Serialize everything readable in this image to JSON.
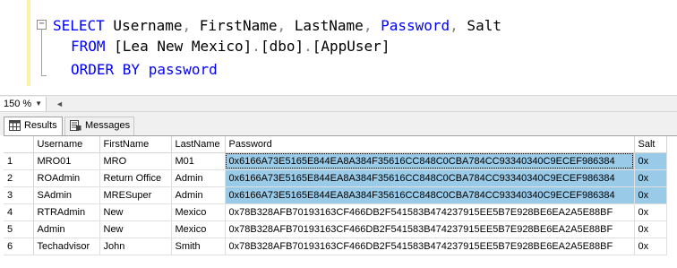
{
  "editor": {
    "collapse_glyph": "−",
    "line1": [
      {
        "t": "SELECT",
        "c": "kw"
      },
      {
        "t": " Username",
        "c": ""
      },
      {
        "t": ",",
        "c": "gray"
      },
      {
        "t": " FirstName",
        "c": ""
      },
      {
        "t": ",",
        "c": "gray"
      },
      {
        "t": " LastName",
        "c": ""
      },
      {
        "t": ",",
        "c": "gray"
      },
      {
        "t": " Password",
        "c": "kw"
      },
      {
        "t": ",",
        "c": "gray"
      },
      {
        "t": " Salt",
        "c": ""
      }
    ],
    "line2": [
      {
        "t": "FROM",
        "c": "kw"
      },
      {
        "t": " [Lea New Mexico]",
        "c": ""
      },
      {
        "t": ".",
        "c": "gray"
      },
      {
        "t": "[dbo]",
        "c": ""
      },
      {
        "t": ".",
        "c": "gray"
      },
      {
        "t": "[AppUser]",
        "c": ""
      }
    ],
    "line3": [
      {
        "t": "ORDER BY",
        "c": "kw"
      },
      {
        "t": " password",
        "c": "kw"
      }
    ]
  },
  "zoom": {
    "value": "150 %",
    "arrow": "▼",
    "scroll_left": "◄"
  },
  "tabs": [
    {
      "label": "Results",
      "icon": "grid-icon"
    },
    {
      "label": "Messages",
      "icon": "messages-icon"
    }
  ],
  "grid": {
    "columns": [
      "",
      "Username",
      "FirstName",
      "LastName",
      "Password",
      "Salt"
    ],
    "rows": [
      {
        "n": "1",
        "Username": "MRO01",
        "FirstName": "MRO",
        "LastName": "M01",
        "Password": "0x6166A73E5165E844EA8A384F35616CC848C0CBA784CC93340340C9ECEF986384",
        "Salt": "0x",
        "selected": true
      },
      {
        "n": "2",
        "Username": "ROAdmin",
        "FirstName": "Return Office",
        "LastName": "Admin",
        "Password": "0x6166A73E5165E844EA8A384F35616CC848C0CBA784CC93340340C9ECEF986384",
        "Salt": "0x",
        "selected": true
      },
      {
        "n": "3",
        "Username": "SAdmin",
        "FirstName": "MRESuper",
        "LastName": "Admin",
        "Password": "0x6166A73E5165E844EA8A384F35616CC848C0CBA784CC93340340C9ECEF986384",
        "Salt": "0x",
        "selected": true
      },
      {
        "n": "4",
        "Username": "RTRAdmin",
        "FirstName": "New",
        "LastName": "Mexico",
        "Password": "0x78B328AFB70193163CF466DB2F541583B474237915EE5B7E928BE6EA2A5E88BF",
        "Salt": "0x",
        "selected": false
      },
      {
        "n": "5",
        "Username": "Admin",
        "FirstName": "New",
        "LastName": "Mexico",
        "Password": "0x78B328AFB70193163CF466DB2F541583B474237915EE5B7E928BE6EA2A5E88BF",
        "Salt": "0x",
        "selected": false
      },
      {
        "n": "6",
        "Username": "Techadvisor",
        "FirstName": "John",
        "LastName": "Smith",
        "Password": "0x78B328AFB70193163CF466DB2F541583B474237915EE5B7E928BE6EA2A5E88BF",
        "Salt": "0x",
        "selected": false
      }
    ]
  },
  "colors": {
    "keyword": "#0000ff",
    "punctuation": "#808080",
    "selection": "#99cae8",
    "change_margin": "#fbf2a4"
  }
}
